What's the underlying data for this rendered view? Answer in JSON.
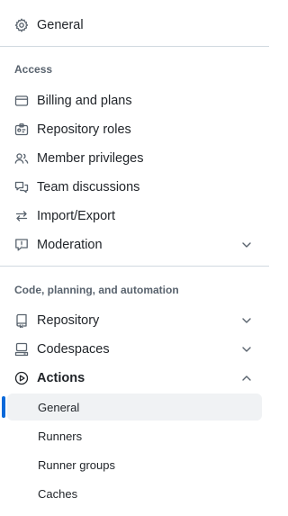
{
  "general": {
    "label": "General",
    "icon": "gear-icon"
  },
  "access": {
    "heading": "Access",
    "items": [
      {
        "label": "Billing and plans",
        "icon": "credit-card-icon"
      },
      {
        "label": "Repository roles",
        "icon": "id-badge-icon"
      },
      {
        "label": "Member privileges",
        "icon": "people-icon"
      },
      {
        "label": "Team discussions",
        "icon": "comment-discussion-icon"
      },
      {
        "label": "Import/Export",
        "icon": "arrow-switch-icon"
      },
      {
        "label": "Moderation",
        "icon": "report-icon",
        "expandable": true
      }
    ]
  },
  "code": {
    "heading": "Code, planning, and automation",
    "items": [
      {
        "label": "Repository",
        "icon": "repo-icon",
        "expandable": true
      },
      {
        "label": "Codespaces",
        "icon": "codespaces-icon",
        "expandable": true
      },
      {
        "label": "Actions",
        "icon": "play-icon",
        "expanded": true
      }
    ],
    "actions_subitems": [
      {
        "label": "General",
        "active": true
      },
      {
        "label": "Runners"
      },
      {
        "label": "Runner groups"
      },
      {
        "label": "Caches"
      }
    ]
  },
  "colors": {
    "accent": "#0969da",
    "active_bg": "#f0f2f4",
    "muted_text": "#59636e",
    "divider": "#d1d9e0"
  }
}
